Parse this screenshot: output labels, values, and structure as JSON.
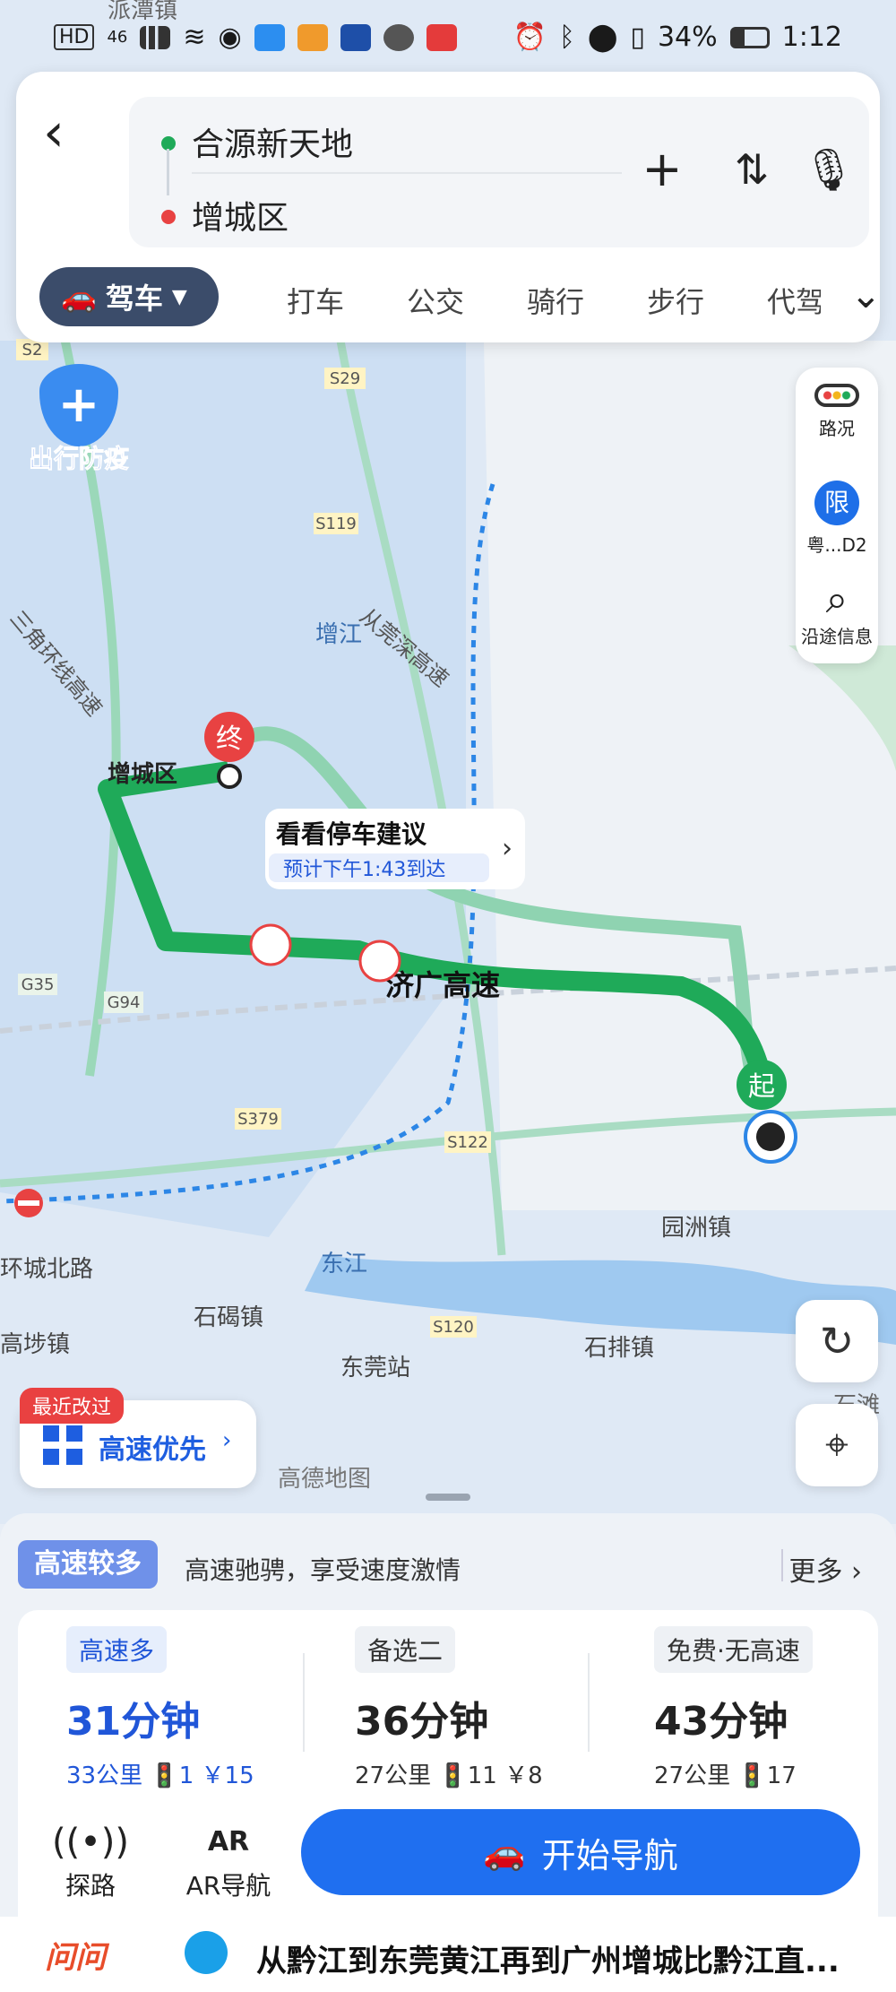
{
  "status": {
    "hd": "HD",
    "net": "46",
    "battery": "34%",
    "time": "1:12"
  },
  "route": {
    "origin": "合源新天地",
    "destination": "增城区"
  },
  "modes": {
    "drive": "驾车",
    "items": [
      "打车",
      "公交",
      "骑行",
      "步行",
      "代驾"
    ]
  },
  "map": {
    "badge": "出行防疫",
    "place_labels": {
      "s2": "S2",
      "s29": "S29",
      "s119": "S119",
      "g35": "G35",
      "g94": "G94",
      "s379": "S379",
      "s122": "S122",
      "s120": "S120",
      "zengcheng": "增城区",
      "yuanzhou": "园洲镇",
      "shijie": "石碣镇",
      "shipai": "石排镇",
      "dongguan": "东莞站",
      "dongjiang": "东江",
      "gaode": "高德地图",
      "huancheng": "环城北路",
      "gaobu": "高埗镇",
      "zengjiang": "增江",
      "expressway": "济广高速",
      "congguan": "从莞深高速",
      "sanjiao": "三角环线高速",
      "paitan": "派潭镇",
      "shitan": "石滩"
    },
    "end_marker": "终",
    "start_marker": "起",
    "parking_title": "看看停车建议",
    "parking_sub": "预计下午1:43到达",
    "colors": {
      "route": "#1faa59",
      "alt": "#8fd3b1",
      "boundary": "#2c86e6",
      "water": "#cfe0f5"
    }
  },
  "side": {
    "traffic": "路况",
    "limit": "粤...D2",
    "limit_icon": "限",
    "along": "沿途信息"
  },
  "pref": {
    "tag": "最近改过",
    "label": "高速优先"
  },
  "tip": {
    "tag": "高速较多",
    "desc": "高速驰骋，享受速度激情",
    "more": "更多"
  },
  "options": [
    {
      "tag": "高速多",
      "time": "31分钟",
      "meta": "33公里 🚦1 ￥15"
    },
    {
      "tag": "备选二",
      "time": "36分钟",
      "meta": "27公里 🚦11 ￥8"
    },
    {
      "tag": "免费·无高速",
      "time": "43分钟",
      "meta": "27公里 🚦17"
    }
  ],
  "tools": {
    "probe": "探路",
    "ar": "AR导航",
    "ar_icon": "AR"
  },
  "start_btn": "开始导航",
  "ask": {
    "logo": "问问",
    "question": "从黔江到东莞黄江再到广州增城比黔江直..."
  }
}
